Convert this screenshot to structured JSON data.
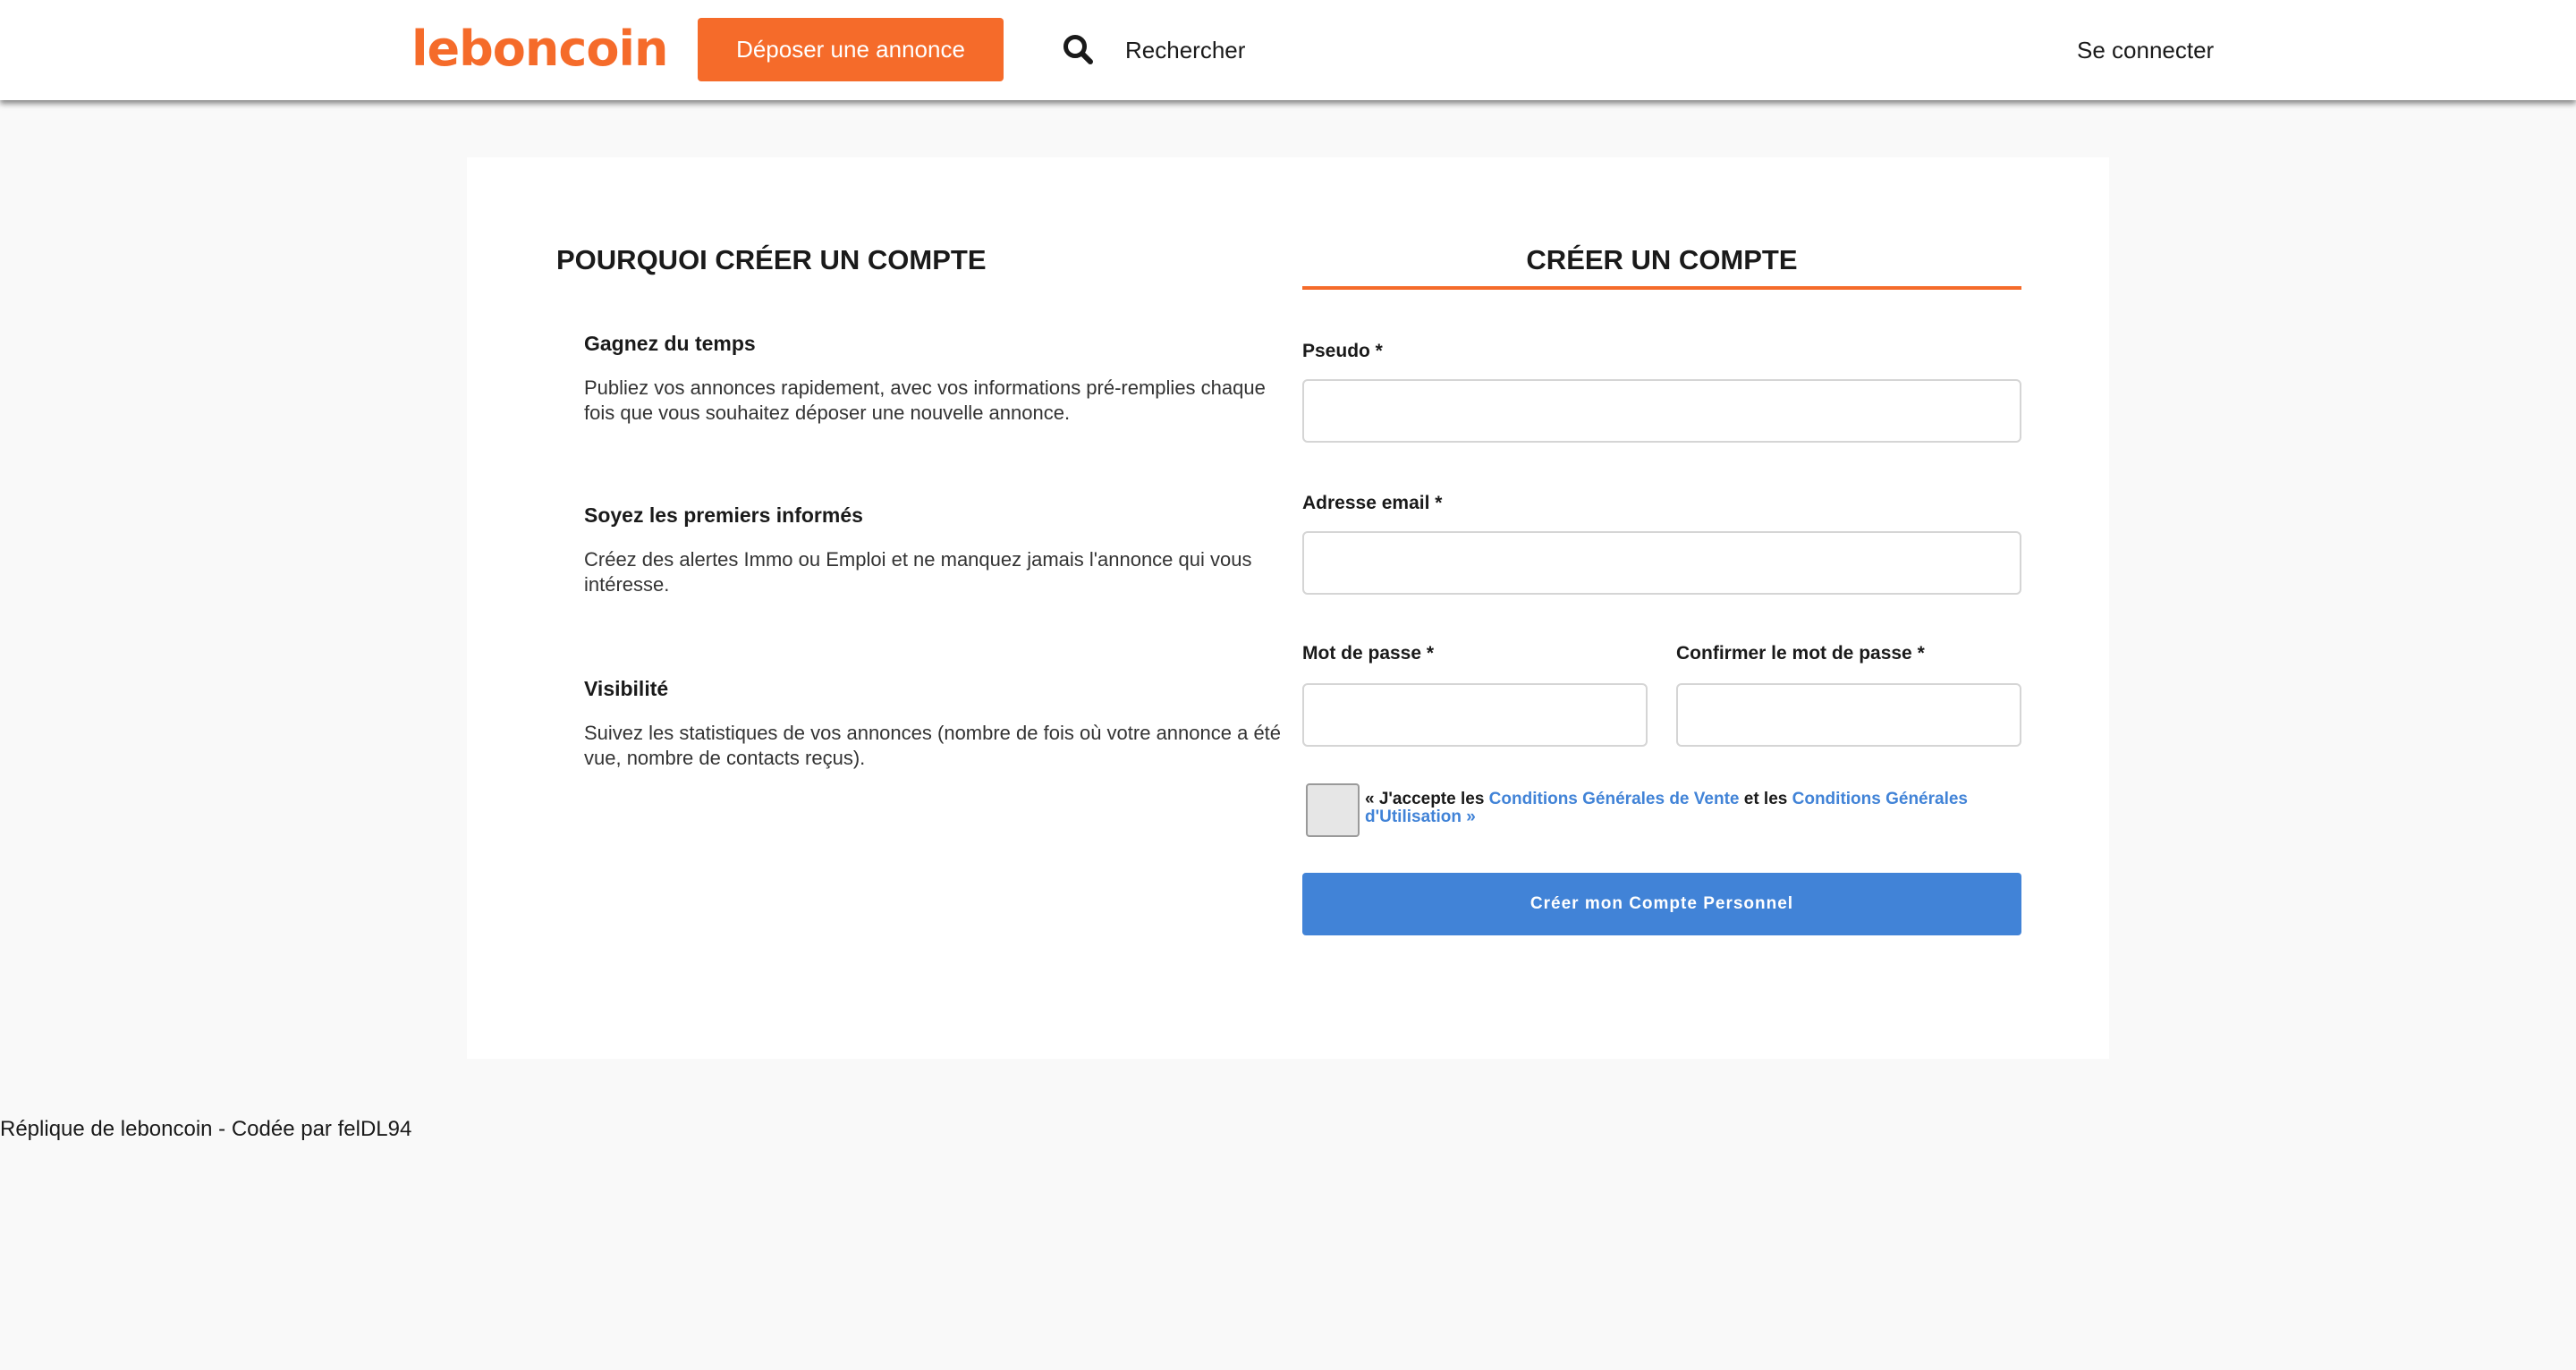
{
  "header": {
    "logo_text": "leboncoin",
    "deposit_label": "Déposer une annonce",
    "search_icon": "search-icon",
    "search_label": "Rechercher",
    "login_label": "Se connecter",
    "brand_color": "#f56b2a"
  },
  "left": {
    "title": "POURQUOI CRÉER UN COMPTE",
    "benefits": [
      {
        "title": "Gagnez du temps",
        "text": "Publiez vos annonces rapidement, avec vos informations pré-remplies chaque fois que vous souhaitez déposer une nouvelle annonce."
      },
      {
        "title": "Soyez les premiers informés",
        "text": "Créez des alertes Immo ou Emploi et ne manquez jamais l'annonce qui vous intéresse."
      },
      {
        "title": "Visibilité",
        "text": "Suivez les statistiques de vos annonces (nombre de fois où votre annonce a été vue, nombre de contacts reçus)."
      }
    ]
  },
  "form": {
    "title": "CRÉER UN COMPTE",
    "pseudo_label": "Pseudo *",
    "pseudo_value": "",
    "email_label": "Adresse email *",
    "email_value": "",
    "password_label": "Mot de passe *",
    "password_value": "",
    "confirm_label": "Confirmer le mot de passe *",
    "confirm_value": "",
    "terms_prefix": "« J'accepte les ",
    "terms_cgv": "Conditions Générales de Vente",
    "terms_middle": " et les ",
    "terms_cgu": "Conditions Générales d'Utilisation »",
    "submit_label": "Créer mon Compte Personnel",
    "accent_color": "#4183d7"
  },
  "footer": {
    "text": "Réplique de leboncoin - Codée par felDL94"
  }
}
